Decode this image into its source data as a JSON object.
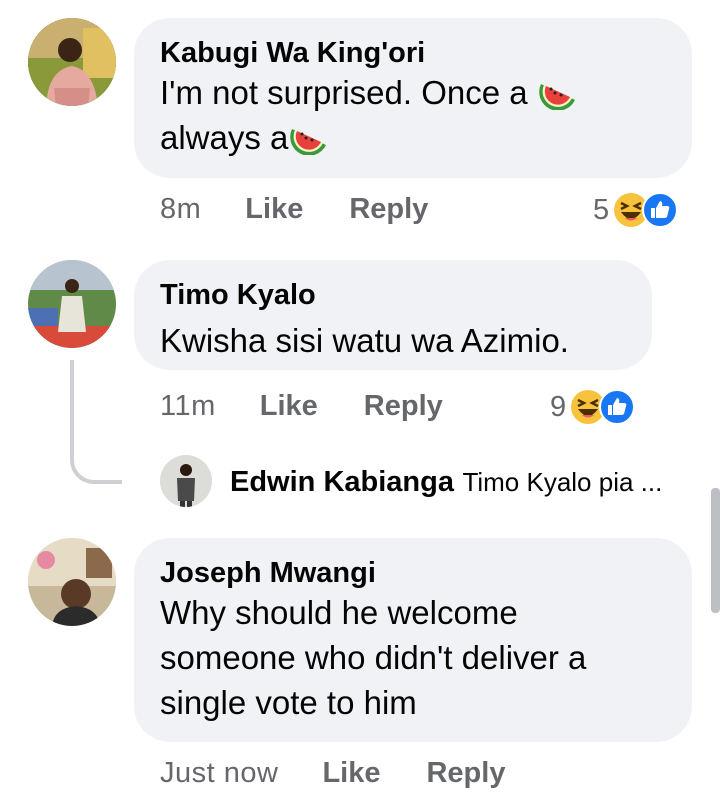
{
  "comments": [
    {
      "author": "Kabugi Wa King'ori",
      "text_line1": "I'm not surprised. Once a",
      "text_line2": "always a",
      "time": "8m",
      "like": "Like",
      "reply": "Reply",
      "reaction_count": "5",
      "reaction_icons": [
        "haha-emoji-icon",
        "like-emoji-icon"
      ]
    },
    {
      "author": "Timo Kyalo",
      "text": "Kwisha sisi watu wa Azimio.",
      "time": "11m",
      "like": "Like",
      "reply": "Reply",
      "reaction_count": "9",
      "reaction_icons": [
        "haha-emoji-icon",
        "like-emoji-icon"
      ],
      "reply_preview": {
        "author": "Edwin Kabianga",
        "snippet": "Timo Kyalo pia ..."
      }
    },
    {
      "author": "Joseph Mwangi",
      "text_line1": "Why should he welcome",
      "text_line2": "someone who didn't deliver a",
      "text_line3": "single vote to him",
      "time": "Just now",
      "like": "Like",
      "reply": "Reply"
    }
  ],
  "colors": {
    "bubble": "#f0f2f5",
    "meta_text": "#65676b",
    "like_blue": "#1877f2",
    "haha_yellow": "#f7c33c"
  }
}
